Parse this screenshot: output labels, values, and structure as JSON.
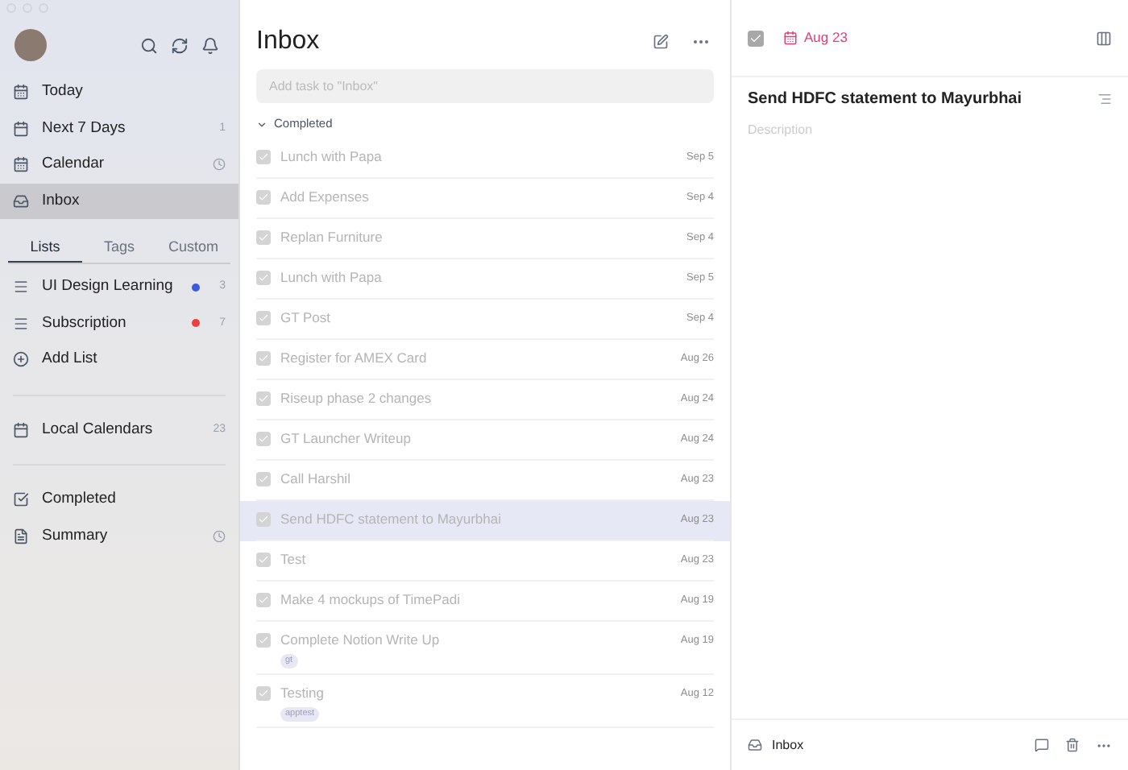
{
  "sidebar": {
    "nav": [
      {
        "label": "Today",
        "kind": "today",
        "selected": false
      },
      {
        "label": "Next 7 Days",
        "kind": "week",
        "count": "1",
        "selected": false
      },
      {
        "label": "Calendar",
        "kind": "calendar",
        "selected": false
      },
      {
        "label": "Inbox",
        "kind": "inbox",
        "selected": true
      }
    ],
    "tabs": [
      {
        "label": "Lists",
        "selected": true
      },
      {
        "label": "Tags",
        "selected": false
      },
      {
        "label": "Custom",
        "selected": false
      }
    ],
    "lists": [
      {
        "label": "UI Design Learning",
        "color": "#3b5bdb",
        "count": "3"
      },
      {
        "label": "Subscription",
        "color": "#f03e3e",
        "count": "7"
      }
    ],
    "add_list": "Add List",
    "local_calendars": {
      "label": "Local Calendars",
      "count": "23"
    },
    "bottom": [
      {
        "label": "Completed",
        "kind": "completed"
      },
      {
        "label": "Summary",
        "kind": "summary"
      }
    ]
  },
  "list": {
    "title": "Inbox",
    "add_placeholder": "Add task to \"Inbox\"",
    "section": "Completed",
    "section_expanded": true,
    "tasks": [
      {
        "title": "Lunch with Papa",
        "date": "Sep 5",
        "checked": true,
        "selected": false
      },
      {
        "title": "Add Expenses",
        "date": "Sep 4",
        "checked": true,
        "selected": false
      },
      {
        "title": "Replan Furniture",
        "date": "Sep 4",
        "checked": true,
        "selected": false
      },
      {
        "title": "Lunch with Papa",
        "date": "Sep 5",
        "checked": true,
        "selected": false
      },
      {
        "title": "GT Post",
        "date": "Sep 4",
        "checked": true,
        "selected": false
      },
      {
        "title": "Register for AMEX Card",
        "date": "Aug 26",
        "checked": true,
        "selected": false
      },
      {
        "title": "Riseup phase 2 changes",
        "date": "Aug 24",
        "checked": true,
        "selected": false
      },
      {
        "title": "GT Launcher Writeup",
        "date": "Aug 24",
        "checked": true,
        "selected": false
      },
      {
        "title": "Call Harshil",
        "date": "Aug 23",
        "checked": true,
        "selected": false
      },
      {
        "title": "Send HDFC statement to Mayurbhai",
        "date": "Aug 23",
        "checked": true,
        "selected": true
      },
      {
        "title": "Test",
        "date": "Aug 23",
        "checked": true,
        "selected": false
      },
      {
        "title": "Make 4 mockups of TimePadi",
        "date": "Aug 19",
        "checked": true,
        "selected": false
      },
      {
        "title": "Complete Notion Write Up",
        "date": "Aug 19",
        "checked": true,
        "selected": false,
        "tag": "gt"
      },
      {
        "title": "Testing",
        "date": "Aug 12",
        "checked": true,
        "selected": false,
        "tag": "apptest"
      }
    ]
  },
  "detail": {
    "checked": true,
    "date": "Aug 23",
    "title": "Send HDFC statement to Mayurbhai",
    "description_placeholder": "Description",
    "list": "Inbox"
  }
}
